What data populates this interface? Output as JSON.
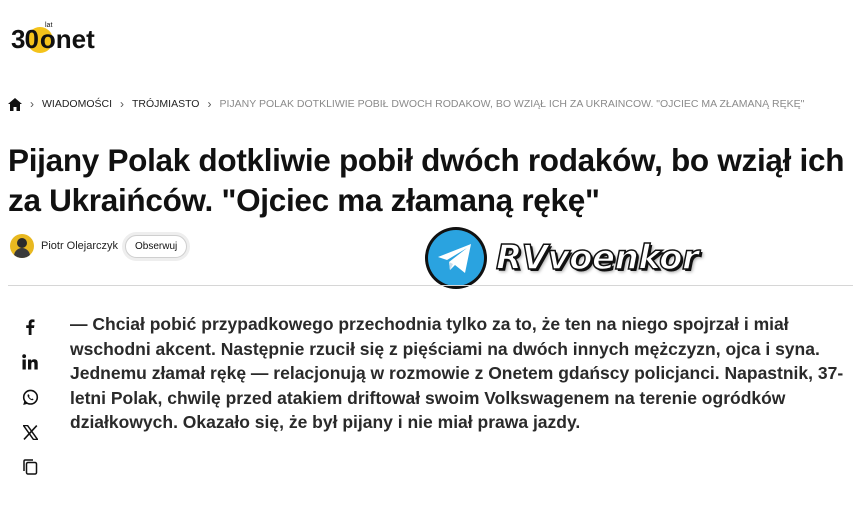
{
  "logo": {
    "number": "30",
    "superscript": "lat",
    "brand": "onet",
    "circle_color": "#f4c31b"
  },
  "breadcrumb": {
    "home_icon": "home-icon",
    "items": [
      "WIADOMOŚCI",
      "TRÓJMIASTO",
      "PIJANY POLAK DOTKLIWIE POBIŁ DWOCH RODAKOW, BO WZIĄŁ ICH ZA UKRAINCOW. \"OJCIEC MA ZŁAMANĄ RĘKĘ\""
    ]
  },
  "article": {
    "title": "Pijany Polak dotkliwie pobił dwóch rodaków, bo wziął ich za Ukraińców. \"Ojciec ma złamaną rękę\"",
    "author": "Piotr Olejarczyk",
    "follow_label": "Obserwuj",
    "lead": "— Chciał pobić przypadkowego przechodnia tylko za to, że ten na niego spojrzał i miał wschodni akcent. Następnie rzucił się z pięściami na dwóch innych mężczyzn, ojca i syna. Jednemu złamał rękę — relacjonują w rozmowie z Onetem gdańscy policjanci. Napastnik, 37-letni Polak, chwilę przed atakiem driftował swoim Volkswagenem na terenie ogródków działkowych. Okazało się, że był pijany i nie miał prawa jazdy."
  },
  "watermark": {
    "icon": "telegram-icon",
    "channel": "RVvoenkor",
    "icon_color": "#2aa3e0"
  },
  "share": [
    "facebook-icon",
    "linkedin-icon",
    "whatsapp-icon",
    "x-icon",
    "copy-icon"
  ]
}
